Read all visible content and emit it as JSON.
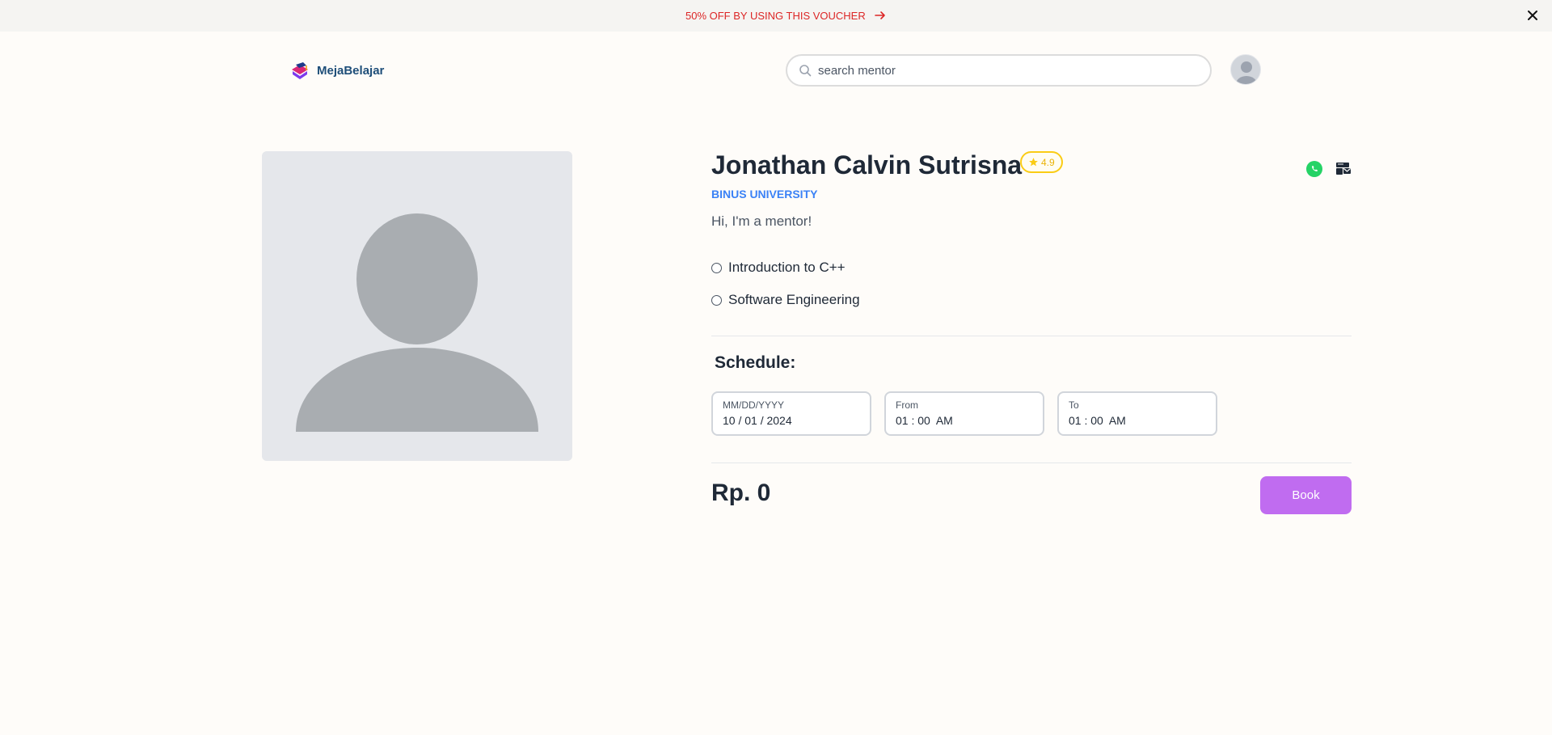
{
  "promo": {
    "text": "50% OFF BY USING THIS VOUCHER"
  },
  "header": {
    "logo_text": "MejaBelajar",
    "search_placeholder": "search mentor"
  },
  "mentor": {
    "name": "Jonathan Calvin Sutrisna",
    "rating": "4.9",
    "university": "BINUS UNIVERSITY",
    "bio": "Hi, I'm a mentor!",
    "courses": [
      "Introduction to C++",
      "Software Engineering"
    ]
  },
  "schedule": {
    "label": "Schedule:",
    "date": {
      "label": "MM/DD/YYYY",
      "value": "10 / 01 / 2024"
    },
    "from": {
      "label": "From",
      "value": "01 : 00  AM"
    },
    "to": {
      "label": "To",
      "value": "01 : 00  AM"
    }
  },
  "price": "Rp. 0",
  "book_label": "Book",
  "colors": {
    "accent": "#c06cf0",
    "promo_text": "#dc2626",
    "university": "#3b82f6",
    "rating": "#facc15",
    "whatsapp": "#25d366"
  },
  "icons": {
    "promo": "arrow-right-icon",
    "close": "close-icon",
    "search": "search-icon",
    "rating": "star-icon",
    "contact_1": "whatsapp-icon",
    "contact_2": "mail-card-icon"
  }
}
